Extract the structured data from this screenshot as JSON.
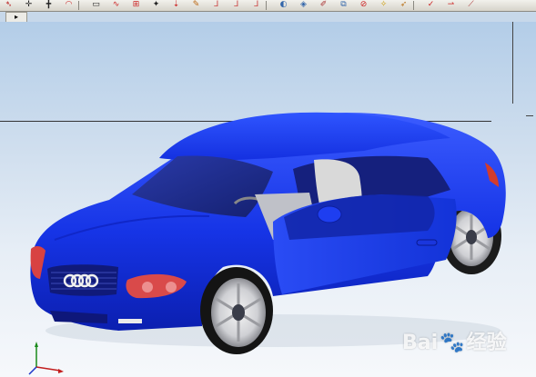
{
  "toolbar": {
    "icons": [
      {
        "name": "arrow-tool-icon",
        "glyph": "➴",
        "color": "#b22"
      },
      {
        "name": "sketch-point-icon",
        "glyph": "✛",
        "color": "#222"
      },
      {
        "name": "line-icon",
        "glyph": "╋",
        "color": "#222"
      },
      {
        "name": "arc-icon",
        "glyph": "◠",
        "color": "#c22"
      },
      {
        "name": "rectangle-icon",
        "glyph": "▭",
        "color": "#222"
      },
      {
        "name": "spline-icon",
        "glyph": "∿",
        "color": "#c22"
      },
      {
        "name": "transform-icon",
        "glyph": "⊞",
        "color": "#c22"
      },
      {
        "name": "pin-icon",
        "glyph": "✦",
        "color": "#222"
      },
      {
        "name": "move-icon",
        "glyph": "⇣",
        "color": "#c22"
      },
      {
        "name": "hint-icon",
        "glyph": "✎",
        "color": "#b61"
      },
      {
        "name": "curve-a-icon",
        "glyph": "ᒧ",
        "color": "#c44"
      },
      {
        "name": "curve-b-icon",
        "glyph": "ᒧ",
        "color": "#c44"
      },
      {
        "name": "curve-c-icon",
        "glyph": "ᒧ",
        "color": "#c44"
      },
      {
        "name": "lens-icon",
        "glyph": "◐",
        "color": "#36a"
      },
      {
        "name": "face-icon",
        "glyph": "◈",
        "color": "#36a"
      },
      {
        "name": "edit-face-icon",
        "glyph": "✐",
        "color": "#a33"
      },
      {
        "name": "mirror-icon",
        "glyph": "⧉",
        "color": "#36a"
      },
      {
        "name": "intersect-icon",
        "glyph": "⊘",
        "color": "#c22"
      },
      {
        "name": "star-icon",
        "glyph": "✧",
        "color": "#c90"
      },
      {
        "name": "pointer-icon",
        "glyph": "➶",
        "color": "#b72"
      },
      {
        "name": "analysis-icon",
        "glyph": "✓",
        "color": "#c22"
      },
      {
        "name": "measure-icon",
        "glyph": "⇀",
        "color": "#c22"
      },
      {
        "name": "tool-x-icon",
        "glyph": "⟋",
        "color": "#a33"
      }
    ]
  },
  "overflow_button": {
    "glyph": "▸"
  },
  "watermark": {
    "text": "Bai",
    "paw": "🐾",
    "suffix": "经验"
  }
}
